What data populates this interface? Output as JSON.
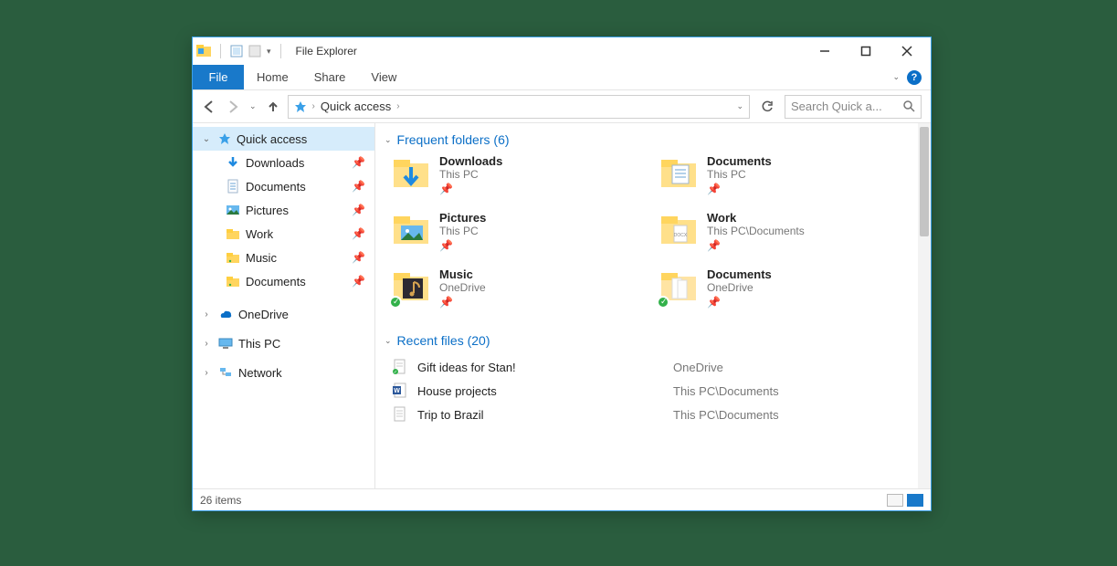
{
  "window": {
    "title": "File Explorer"
  },
  "ribbon": {
    "file": "File",
    "tabs": [
      "Home",
      "Share",
      "View"
    ]
  },
  "address": {
    "crumb": "Quick access",
    "search_placeholder": "Search Quick a..."
  },
  "nav": {
    "quick_access": "Quick access",
    "items": [
      {
        "label": "Downloads",
        "icon": "download"
      },
      {
        "label": "Documents",
        "icon": "doc"
      },
      {
        "label": "Pictures",
        "icon": "pictures"
      },
      {
        "label": "Work",
        "icon": "folder"
      },
      {
        "label": "Music",
        "icon": "music"
      },
      {
        "label": "Documents",
        "icon": "folder"
      }
    ],
    "onedrive": "OneDrive",
    "thispc": "This PC",
    "network": "Network"
  },
  "groups": {
    "frequent": {
      "label": "Frequent folders",
      "count": 6
    },
    "recent": {
      "label": "Recent files",
      "count": 20
    }
  },
  "folders": [
    {
      "name": "Downloads",
      "location": "This PC",
      "icon": "download",
      "sync": false
    },
    {
      "name": "Documents",
      "location": "This PC",
      "icon": "doc",
      "sync": false
    },
    {
      "name": "Pictures",
      "location": "This PC",
      "icon": "pictures",
      "sync": false
    },
    {
      "name": "Work",
      "location": "This PC\\Documents",
      "icon": "docx",
      "sync": false
    },
    {
      "name": "Music",
      "location": "OneDrive",
      "icon": "music-dark",
      "sync": true
    },
    {
      "name": "Documents",
      "location": "OneDrive",
      "icon": "folder-open",
      "sync": true
    }
  ],
  "files": [
    {
      "name": "Gift ideas for Stan!",
      "location": "OneDrive",
      "icon": "txt-sync"
    },
    {
      "name": "House projects",
      "location": "This PC\\Documents",
      "icon": "word"
    },
    {
      "name": "Trip to Brazil",
      "location": "This PC\\Documents",
      "icon": "txt"
    }
  ],
  "status": {
    "items_count": "26 items"
  }
}
